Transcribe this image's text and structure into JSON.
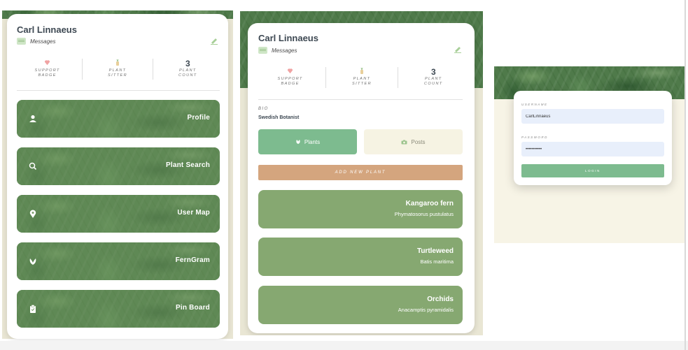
{
  "colors": {
    "accent_green": "#7dbb8f",
    "plant_card": "#86a871",
    "add_button": "#d4a57e",
    "cream": "#f6f3e3",
    "input_bg": "#e8effb"
  },
  "profile_menu": {
    "username": "Carl Linnaeus",
    "messages_label": "Messages",
    "stats": [
      {
        "icon": "support-badge-icon",
        "value": "",
        "label": "SUPPORT\nBADGE"
      },
      {
        "icon": "plant-sitter-icon",
        "value": "",
        "label": "PLANT\nSITTER"
      },
      {
        "icon": "",
        "value": "3",
        "label": "PLANT\nCOUNT"
      }
    ],
    "menu": [
      {
        "icon": "user-icon",
        "label": "Profile"
      },
      {
        "icon": "search-icon",
        "label": "Plant Search"
      },
      {
        "icon": "map-pin-icon",
        "label": "User Map"
      },
      {
        "icon": "fern-icon",
        "label": "FernGram"
      },
      {
        "icon": "clipboard-icon",
        "label": "Pin Board"
      }
    ]
  },
  "profile_detail": {
    "username": "Carl Linnaeus",
    "messages_label": "Messages",
    "stats": [
      {
        "icon": "support-badge-icon",
        "value": "",
        "label": "SUPPORT\nBADGE"
      },
      {
        "icon": "plant-sitter-icon",
        "value": "",
        "label": "PLANT\nSITTER"
      },
      {
        "icon": "",
        "value": "3",
        "label": "PLANT\nCOUNT"
      }
    ],
    "bio_heading": "BIO",
    "bio": "Swedish Botanist",
    "tabs": {
      "plants": "Plants",
      "posts": "Posts"
    },
    "add_plant_label": "ADD NEW PLANT",
    "plants": [
      {
        "name": "Kangaroo fern",
        "scientific": "Phymatosorus pustulatus"
      },
      {
        "name": "Turtleweed",
        "scientific": "Batis maritima"
      },
      {
        "name": "Orchids",
        "scientific": "Anacamptis pyramidalis"
      }
    ]
  },
  "login": {
    "username_label": "USERNAME",
    "username_value": "CarlLinnaeus",
    "password_label": "PASSWORD",
    "password_value": "•••••••••••",
    "login_label": "LOGIN"
  }
}
